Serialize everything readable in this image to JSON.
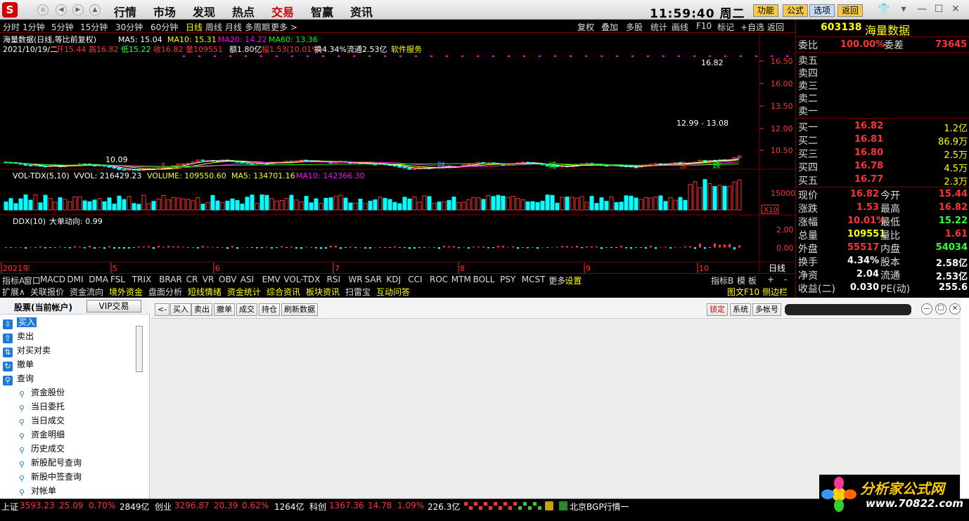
{
  "top": {
    "menus": [
      "行情",
      "市场",
      "发现",
      "热点",
      "交易",
      "智赢",
      "资讯"
    ],
    "active_menu": "交易",
    "clock": "11:59:40 周二",
    "buttons": [
      "功能",
      "公式",
      "选项",
      "返回"
    ]
  },
  "period": {
    "items": [
      "分时",
      "1分钟",
      "5分钟",
      "15分钟",
      "30分钟",
      "60分钟",
      "日线",
      "周线",
      "月线",
      "多周期",
      "更多 >"
    ],
    "selected": "日线",
    "tools": [
      "复权",
      "叠加",
      "多股",
      "统计",
      "画线",
      "F10",
      "标记",
      "+自选",
      "返回"
    ]
  },
  "chart": {
    "title": "海量数据(日线,等比前复权)",
    "ma": [
      {
        "label": "MA5: 15.04",
        "color": "#ffffff"
      },
      {
        "label": "MA10: 15.31",
        "color": "#ffff00"
      },
      {
        "label": "MA20: 14.22",
        "color": "#ff00ff"
      },
      {
        "label": "MA60: 13.36",
        "color": "#00ff00"
      }
    ],
    "info_date": "2021/10/19/二",
    "info": [
      {
        "t": "开15.44",
        "c": "#ff3333"
      },
      {
        "t": "高16.82",
        "c": "#ff3333"
      },
      {
        "t": "低15.22",
        "c": "#33ff33"
      },
      {
        "t": "收16.82",
        "c": "#ff3333"
      },
      {
        "t": "量109551",
        "c": "#ff3333"
      },
      {
        "t": "额1.80亿",
        "c": "#ffffff"
      },
      {
        "t": "幅1.53(10.01%)",
        "c": "#ff3333"
      },
      {
        "t": "换4.34%",
        "c": "#ffffff"
      },
      {
        "t": "流通2.53亿",
        "c": "#ffffff"
      },
      {
        "t": "软件服务",
        "c": "#ffff00"
      }
    ],
    "y_ticks": [
      "16.50",
      "16.00",
      "13.50",
      "12.00",
      "10.50"
    ],
    "annot_high": "16.82",
    "annot_low": "10.09",
    "annot_range": "12.99 - 13.08",
    "events": [
      {
        "t": "$",
        "c": "#ff3333"
      },
      {
        "t": "财",
        "c": "#6688ff"
      },
      {
        "t": "减",
        "c": "#00ff00"
      },
      {
        "t": "涨",
        "c": "#ff3333"
      },
      {
        "t": "跌",
        "c": "#00ff00"
      }
    ],
    "vol_title": "VOL-TDX(5,10)",
    "vol_vals": [
      {
        "t": "VVOL: 216429.23",
        "c": "#ffffff"
      },
      {
        "t": "VOLUME: 109550.60",
        "c": "#ffff00"
      },
      {
        "t": "MA5: 134701.16",
        "c": "#ffff00"
      },
      {
        "t": "MA10: 142366.30",
        "c": "#ff00ff"
      }
    ],
    "vol_tick": "15000",
    "vol_unit": "X10",
    "ddx_title": "DDX(10)",
    "ddx_val": "大单动向: 0.99",
    "ddx_ticks": [
      "2.00",
      "0.00"
    ],
    "x_labels": [
      "2021年",
      "5",
      "6",
      "7",
      "8",
      "9",
      "10"
    ],
    "x_right": "日线"
  },
  "tabs": [
    "指标A",
    "窗口",
    "MACD",
    "DMI",
    "DMA",
    "FSL",
    "TRIX",
    "BRAR",
    "CR",
    "VR",
    "OBV",
    "ASI",
    "EMV",
    "VOL-TDX",
    "RSI",
    "WR",
    "SAR",
    "KDJ",
    "CCI",
    "ROC",
    "MTM",
    "BOLL",
    "PSY",
    "MCST",
    "更多",
    "设置"
  ],
  "tabs_right": [
    "指标B",
    "模 板",
    "+",
    "-"
  ],
  "tabs2": [
    {
      "t": "扩展∧",
      "c": "#dddddd"
    },
    {
      "t": "关联报价",
      "c": "#dddddd"
    },
    {
      "t": "资金流向",
      "c": "#dddddd"
    },
    {
      "t": "境外资金",
      "c": "#ffff00"
    },
    {
      "t": "盘面分析",
      "c": "#dddddd"
    },
    {
      "t": "短线情绪",
      "c": "#ffff00"
    },
    {
      "t": "资金统计",
      "c": "#ffff00"
    },
    {
      "t": "综合资讯",
      "c": "#ffff00"
    },
    {
      "t": "板块资讯",
      "c": "#ffff00"
    },
    {
      "t": "扫雷宝",
      "c": "#dddddd"
    },
    {
      "t": "互动问答",
      "c": "#ffff00"
    }
  ],
  "tabs2_right": "图文F10 侧边栏《",
  "quote": {
    "code": "603138",
    "name": "海量数据",
    "weibi_label": "委比",
    "weibi": "100.00%",
    "weicha_label": "委差",
    "weicha": "73645",
    "sell": [
      {
        "l": "卖五",
        "p": "",
        "v": ""
      },
      {
        "l": "卖四",
        "p": "",
        "v": ""
      },
      {
        "l": "卖三",
        "p": "",
        "v": ""
      },
      {
        "l": "卖二",
        "p": "",
        "v": ""
      },
      {
        "l": "卖一",
        "p": "",
        "v": ""
      }
    ],
    "buy": [
      {
        "l": "买一",
        "p": "16.82",
        "v": "1.2亿"
      },
      {
        "l": "买二",
        "p": "16.81",
        "v": "86.9万"
      },
      {
        "l": "买三",
        "p": "16.80",
        "v": "2.5万"
      },
      {
        "l": "买四",
        "p": "16.78",
        "v": "4.5万"
      },
      {
        "l": "买五",
        "p": "16.77",
        "v": "2.3万"
      }
    ],
    "stats": [
      {
        "a": "现价",
        "av": "16.82",
        "ac": "#ff3333",
        "b": "今开",
        "bv": "15.44",
        "bc": "#ff3333"
      },
      {
        "a": "涨跌",
        "av": "1.53",
        "ac": "#ff3333",
        "b": "最高",
        "bv": "16.82",
        "bc": "#ff3333"
      },
      {
        "a": "涨幅",
        "av": "10.01%",
        "ac": "#ff3333",
        "b": "最低",
        "bv": "15.22",
        "bc": "#33ff33"
      },
      {
        "a": "总量",
        "av": "109551",
        "ac": "#ffff00",
        "b": "量比",
        "bv": "1.61",
        "bc": "#ff3333"
      },
      {
        "a": "外盘",
        "av": "55517",
        "ac": "#ff3333",
        "b": "内盘",
        "bv": "54034",
        "bc": "#33ff33"
      },
      {
        "a": "换手",
        "av": "4.34%",
        "ac": "#ffffff",
        "b": "股本",
        "bv": "2.58亿",
        "bc": "#ffffff"
      },
      {
        "a": "净资",
        "av": "2.04",
        "ac": "#ffffff",
        "b": "流通",
        "bv": "2.53亿",
        "bc": "#ffffff"
      },
      {
        "a": "收益(二)",
        "av": "0.030",
        "ac": "#ffffff",
        "b": "PE(动)",
        "bv": "255.6",
        "bc": "#ffffff"
      }
    ]
  },
  "trade": {
    "header": "股票(当前帐户)",
    "vip": "VIP交易",
    "tree": [
      "买入",
      "卖出",
      "对买对卖",
      "撤单",
      "查询",
      "资金股份",
      "当日委托",
      "当日成交",
      "资金明细",
      "历史成交",
      "新股配号查询",
      "新股中签查询",
      "对帐单"
    ],
    "toolbar": [
      "<-",
      "买入",
      "卖出",
      "撤单",
      "成交",
      "持仓",
      "刷新数据"
    ],
    "right_btns": [
      "锁定",
      "系统",
      "多帐号"
    ]
  },
  "status": {
    "items": [
      {
        "t": "上证",
        "c": "#ffffff"
      },
      {
        "t": "3593.23",
        "c": "#ff3333"
      },
      {
        "t": "25.09",
        "c": "#ff3333"
      },
      {
        "t": "0.70%",
        "c": "#ff3333"
      },
      {
        "t": "2849亿",
        "c": "#ffffff"
      },
      {
        "t": "创业",
        "c": "#ffffff"
      },
      {
        "t": "3296.87",
        "c": "#ff3333"
      },
      {
        "t": "20.39",
        "c": "#ff3333"
      },
      {
        "t": "0.62%",
        "c": "#ff3333"
      },
      {
        "t": "1264亿",
        "c": "#ffffff"
      },
      {
        "t": "科创",
        "c": "#ffffff"
      },
      {
        "t": "1367.36",
        "c": "#ff3333"
      },
      {
        "t": "14.78",
        "c": "#ff3333"
      },
      {
        "t": "1.09%",
        "c": "#ff3333"
      },
      {
        "t": "226.3亿",
        "c": "#ffffff"
      }
    ],
    "server": "北京BGP行情一"
  },
  "watermark": {
    "brand": "分析家公式网",
    "url": "www.70822.com"
  },
  "colors": {
    "up": "#ff3333",
    "down": "#00ffff",
    "bg": "#000000",
    "grid": "#7a0000"
  }
}
